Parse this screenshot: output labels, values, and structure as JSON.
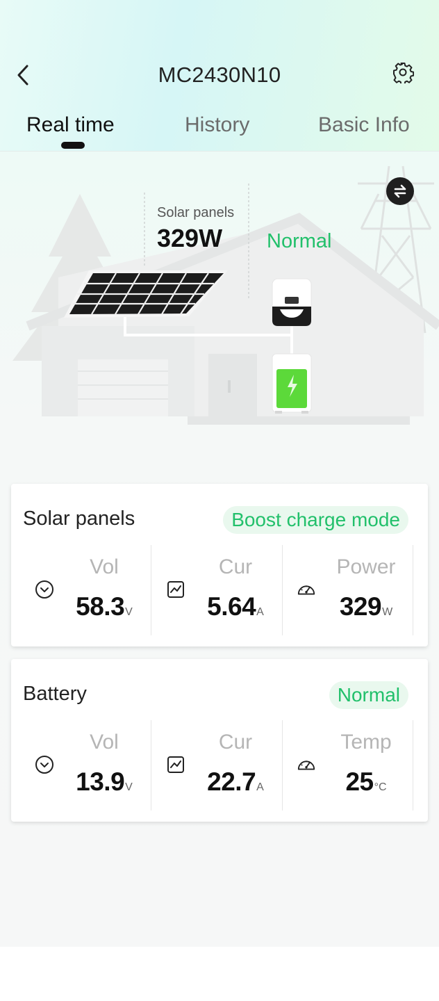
{
  "header": {
    "title": "MC2430N10",
    "back_icon": "chevron-left-icon",
    "settings_icon": "gear-icon"
  },
  "tabs": [
    {
      "label": "Real time",
      "active": true
    },
    {
      "label": "History",
      "active": false
    },
    {
      "label": "Basic Info",
      "active": false
    }
  ],
  "scene": {
    "solar_label": "Solar panels",
    "solar_value": "329W",
    "status": "Normal",
    "swap_icon": "swap-icon",
    "status_color": "#22c06b",
    "battery_color": "#5cd93a"
  },
  "cards": {
    "solar": {
      "title": "Solar panels",
      "badge": "Boost charge mode",
      "metrics": [
        {
          "icon": "voltage-icon",
          "label": "Vol",
          "value": "58.3",
          "unit": "V"
        },
        {
          "icon": "current-chart-icon",
          "label": "Cur",
          "value": "5.64",
          "unit": "A"
        },
        {
          "icon": "gauge-icon",
          "label": "Power",
          "value": "329",
          "unit": "W"
        }
      ]
    },
    "battery": {
      "title": "Battery",
      "badge": "Normal",
      "metrics": [
        {
          "icon": "voltage-icon",
          "label": "Vol",
          "value": "13.9",
          "unit": "V"
        },
        {
          "icon": "current-chart-icon",
          "label": "Cur",
          "value": "22.7",
          "unit": "A"
        },
        {
          "icon": "gauge-icon",
          "label": "Temp",
          "value": "25",
          "unit": "°C"
        }
      ]
    }
  }
}
